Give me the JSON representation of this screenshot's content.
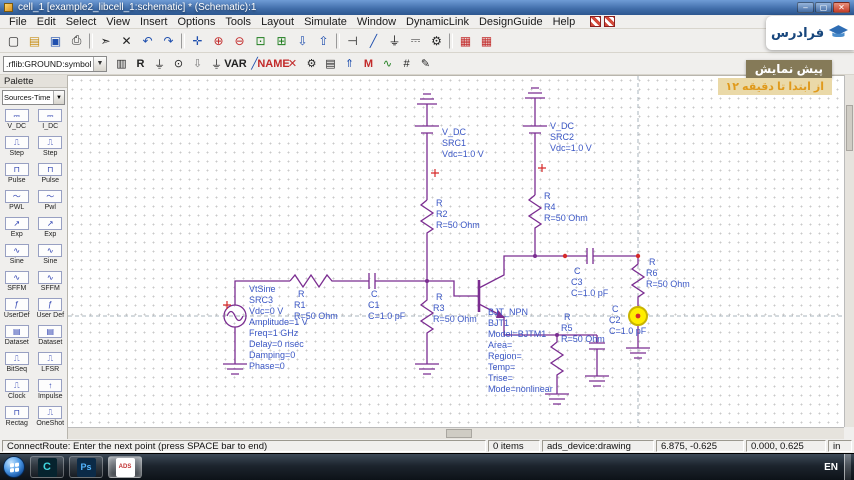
{
  "window": {
    "title": "cell_1 [example2_libcell_1:schematic] * (Schematic):1",
    "controls": {
      "minimize": "‒",
      "maximize": "▢",
      "close": "✕"
    }
  },
  "menu": {
    "items": [
      "File",
      "Edit",
      "Select",
      "View",
      "Insert",
      "Options",
      "Tools",
      "Layout",
      "Simulate",
      "Window",
      "DynamicLink",
      "DesignGuide",
      "Help"
    ],
    "icons": [
      {
        "name": "schematic-window-icon",
        "cls": "redgrid"
      },
      {
        "name": "layout-window-icon",
        "cls": "redgrid"
      }
    ]
  },
  "toolbar_main": {
    "items": [
      {
        "name": "new-file-icon",
        "glyph": "▢",
        "cls": "c-ink"
      },
      {
        "name": "open-folder-icon",
        "glyph": "▤",
        "cls": "c-yellow"
      },
      {
        "name": "save-icon",
        "glyph": "▣",
        "cls": "c-blue"
      },
      {
        "name": "print-icon",
        "glyph": "⎙",
        "cls": "c-ink"
      },
      {
        "name": "separator",
        "glyph": "",
        "cls": "sep"
      },
      {
        "name": "select-pointer-icon",
        "glyph": "➣",
        "cls": "c-ink"
      },
      {
        "name": "delete-icon",
        "glyph": "✕",
        "cls": "c-ink"
      },
      {
        "name": "undo-icon",
        "glyph": "↶",
        "cls": "c-blue"
      },
      {
        "name": "redo-icon",
        "glyph": "↷",
        "cls": "c-blue"
      },
      {
        "name": "separator",
        "glyph": "",
        "cls": "sep"
      },
      {
        "name": "pan-icon",
        "glyph": "✛",
        "cls": "c-blue"
      },
      {
        "name": "zoom-in-icon",
        "glyph": "⊕",
        "cls": "c-red"
      },
      {
        "name": "zoom-out-icon",
        "glyph": "⊖",
        "cls": "c-red"
      },
      {
        "name": "zoom-area-icon",
        "glyph": "⊡",
        "cls": "c-green"
      },
      {
        "name": "view-all-icon",
        "glyph": "⊞",
        "cls": "c-green"
      },
      {
        "name": "push-into-icon",
        "glyph": "⇩",
        "cls": "c-blue"
      },
      {
        "name": "pop-out-icon",
        "glyph": "⇧",
        "cls": "c-blue"
      },
      {
        "name": "separator",
        "glyph": "",
        "cls": "sep"
      },
      {
        "name": "insert-pin-icon",
        "glyph": "⊣",
        "cls": "c-ink"
      },
      {
        "name": "insert-wire-icon",
        "glyph": "╱",
        "cls": "c-blue"
      },
      {
        "name": "insert-ground-icon",
        "glyph": "⏚",
        "cls": "c-ink"
      },
      {
        "name": "insert-vdc-icon",
        "glyph": "⎓",
        "cls": "c-ink"
      },
      {
        "name": "simulation-settings-icon",
        "glyph": "⚙",
        "cls": "c-ink"
      },
      {
        "name": "separator",
        "glyph": "",
        "cls": "sep"
      },
      {
        "name": "stop-simulation-icon",
        "glyph": "▦",
        "cls": "c-red"
      },
      {
        "name": "stop-all-simulations-icon",
        "glyph": "▦",
        "cls": "c-red"
      }
    ]
  },
  "toolbar_insert": {
    "combo_value": ".rflib:GROUND:symbol",
    "items": [
      {
        "name": "library-list-icon",
        "glyph": "▥",
        "cls": "c-ink"
      },
      {
        "name": "component-history-icon",
        "glyph": "R",
        "cls": "c-ink txt"
      },
      {
        "name": "insert-ground-icon",
        "glyph": "⏚",
        "cls": "c-ink"
      },
      {
        "name": "insert-port-icon",
        "glyph": "⊙",
        "cls": "c-ink"
      },
      {
        "name": "arrow-down-icon",
        "glyph": "⇩",
        "cls": "c-dim"
      },
      {
        "name": "insert-ground-alt-icon",
        "glyph": "⏚",
        "cls": "c-ink"
      },
      {
        "name": "var-icon",
        "glyph": "VAR",
        "cls": "c-ink txt"
      },
      {
        "name": "insert-wire-icon",
        "glyph": "╱",
        "cls": "c-blue"
      },
      {
        "name": "wire-label-icon",
        "glyph": "NAME",
        "cls": "c-red txt"
      },
      {
        "name": "deactivate-icon",
        "glyph": "✕",
        "cls": "c-red"
      },
      {
        "name": "simulate-gear-icon",
        "glyph": "⚙",
        "cls": "c-ink"
      },
      {
        "name": "display-columns-icon",
        "glyph": "▤",
        "cls": "c-ink"
      },
      {
        "name": "optimize-up-icon",
        "glyph": "⇑",
        "cls": "c-blue"
      },
      {
        "name": "tune-icon",
        "glyph": "M",
        "cls": "c-red txt"
      },
      {
        "name": "waveform-icon",
        "glyph": "∿",
        "cls": "c-green"
      },
      {
        "name": "measure-icon",
        "glyph": "#",
        "cls": "c-ink"
      },
      {
        "name": "edit-icon",
        "glyph": "✎",
        "cls": "c-ink"
      }
    ]
  },
  "palette": {
    "title": "Palette",
    "category": "Sources-Time Don",
    "items": [
      {
        "label": "V_DC",
        "glyph": "⎓"
      },
      {
        "label": "I_DC",
        "glyph": "⎓"
      },
      {
        "label": "Step",
        "glyph": "⎍"
      },
      {
        "label": "Step",
        "glyph": "⎍"
      },
      {
        "label": "Pulse",
        "glyph": "⊓"
      },
      {
        "label": "Pulse",
        "glyph": "⊓"
      },
      {
        "label": "PWL",
        "glyph": "〜"
      },
      {
        "label": "Pwl",
        "glyph": "〜"
      },
      {
        "label": "Exp",
        "glyph": "↗"
      },
      {
        "label": "Exp",
        "glyph": "↗"
      },
      {
        "label": "Sine",
        "glyph": "∿"
      },
      {
        "label": "Sine",
        "glyph": "∿"
      },
      {
        "label": "SFFM",
        "glyph": "∿"
      },
      {
        "label": "SFFM",
        "glyph": "∿"
      },
      {
        "label": "UserDef",
        "glyph": "ƒ"
      },
      {
        "label": "User Def",
        "glyph": "ƒ"
      },
      {
        "label": "Dataset",
        "glyph": "▤"
      },
      {
        "label": "Dataset",
        "glyph": "▤"
      },
      {
        "label": "BitSeq",
        "glyph": "⎍"
      },
      {
        "label": "LFSR",
        "glyph": "⎍"
      },
      {
        "label": "Clock",
        "glyph": "⎍"
      },
      {
        "label": "Impulse",
        "glyph": "↑"
      },
      {
        "label": "Rectag",
        "glyph": "⊓"
      },
      {
        "label": "OneShot",
        "glyph": "⎍"
      }
    ]
  },
  "schematic": {
    "src3": [
      "VtSine",
      "SRC3",
      "Vdc=0 V",
      "Amplitude=1 V",
      "Freq=1 GHz",
      "Delay=0 nsec",
      "Damping=0",
      "Phase=0"
    ],
    "src1": [
      "V_DC",
      "SRC1",
      "Vdc=1.0 V"
    ],
    "src2": [
      "V_DC",
      "SRC2",
      "Vdc=1.0 V"
    ],
    "r1": [
      "R",
      "R1",
      "R=50 Ohm"
    ],
    "r2": [
      "R",
      "R2",
      "R=50 Ohm"
    ],
    "r3": [
      "R",
      "R3",
      "R=50 Ohm"
    ],
    "r4": [
      "R",
      "R4",
      "R=50 Ohm"
    ],
    "r5": [
      "R",
      "R5",
      "R=50 Ohm"
    ],
    "r6": [
      "R",
      "R6",
      "R=50 Ohm"
    ],
    "c1": [
      "C",
      "C1",
      "C=1.0 pF"
    ],
    "c2": [
      "C",
      "C2",
      "C=1.0 pF"
    ],
    "c3": [
      "C",
      "C3",
      "C=1.0 pF"
    ],
    "bjt1": [
      "BJT_NPN",
      "BJT1",
      "Model=BJTM1",
      "Area=",
      "Region=",
      "Temp=",
      "Trise=",
      "Mode=nonlinear"
    ]
  },
  "statusbar": {
    "hint": "ConnectRoute: Enter the next point (press SPACE bar to end)",
    "items_count": "0 items",
    "mode": "ads_device:drawing",
    "coords_a": "6.875, -0.625",
    "coords_b": "0.000, 0.625",
    "units": "in"
  },
  "taskbar": {
    "apps": [
      {
        "name": "console-app-button",
        "glyph": "C",
        "cls": "console"
      },
      {
        "name": "photoshop-app-button",
        "glyph": "Ps",
        "cls": "ps"
      },
      {
        "name": "ads-app-button",
        "glyph": "ADS",
        "cls": "ads active"
      }
    ],
    "tray_language": "EN"
  },
  "brand": {
    "name": "فرادرس"
  },
  "overlay": {
    "title": "پیش نمایش",
    "subtitle": "از ابتدا تا دقیقه ۱۲"
  }
}
